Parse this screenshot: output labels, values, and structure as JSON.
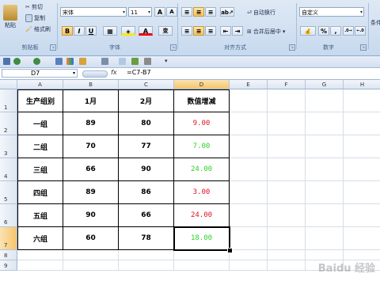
{
  "ribbon": {
    "clipboard": {
      "paste": "粘贴",
      "cut": "剪切",
      "copy": "复制",
      "format_painter": "格式刷",
      "label": "剪贴板"
    },
    "font": {
      "name": "宋体",
      "size": "11",
      "grow": "A",
      "shrink": "A",
      "bold": "B",
      "italic": "I",
      "underline": "U",
      "label": "字体",
      "wen": "变"
    },
    "alignment": {
      "wrap": "自动换行",
      "merge": "合并后居中",
      "label": "对齐方式"
    },
    "number": {
      "format": "自定义",
      "label": "数字",
      "percent": "%",
      "comma": ",",
      "inc": "←.0 .00",
      "dec": ".00 →.0",
      "currency": "%"
    },
    "styles": {
      "label": "条件"
    }
  },
  "formula_bar": {
    "name_box": "D7",
    "fx": "fx",
    "formula": "=C7-B7"
  },
  "columns": [
    "A",
    "B",
    "C",
    "D",
    "E",
    "F",
    "G",
    "H"
  ],
  "rows": [
    "1",
    "2",
    "3",
    "4",
    "5",
    "6",
    "7",
    "8",
    "9"
  ],
  "table": {
    "headers": [
      "生产组别",
      "1月",
      "2月",
      "数值增减"
    ],
    "data": [
      {
        "group": "一组",
        "m1": "89",
        "m2": "80",
        "diff": "9.00",
        "color": "#e0141e"
      },
      {
        "group": "二组",
        "m1": "70",
        "m2": "77",
        "diff": "7.00",
        "color": "#2bd42b"
      },
      {
        "group": "三组",
        "m1": "66",
        "m2": "90",
        "diff": "24.00",
        "color": "#2bd42b"
      },
      {
        "group": "四组",
        "m1": "89",
        "m2": "86",
        "diff": "3.00",
        "color": "#e0141e"
      },
      {
        "group": "五组",
        "m1": "90",
        "m2": "66",
        "diff": "24.00",
        "color": "#e0141e"
      },
      {
        "group": "六组",
        "m1": "60",
        "m2": "78",
        "diff": "18.00",
        "color": "#2bd42b"
      }
    ]
  },
  "watermark": "Baidu 经验"
}
